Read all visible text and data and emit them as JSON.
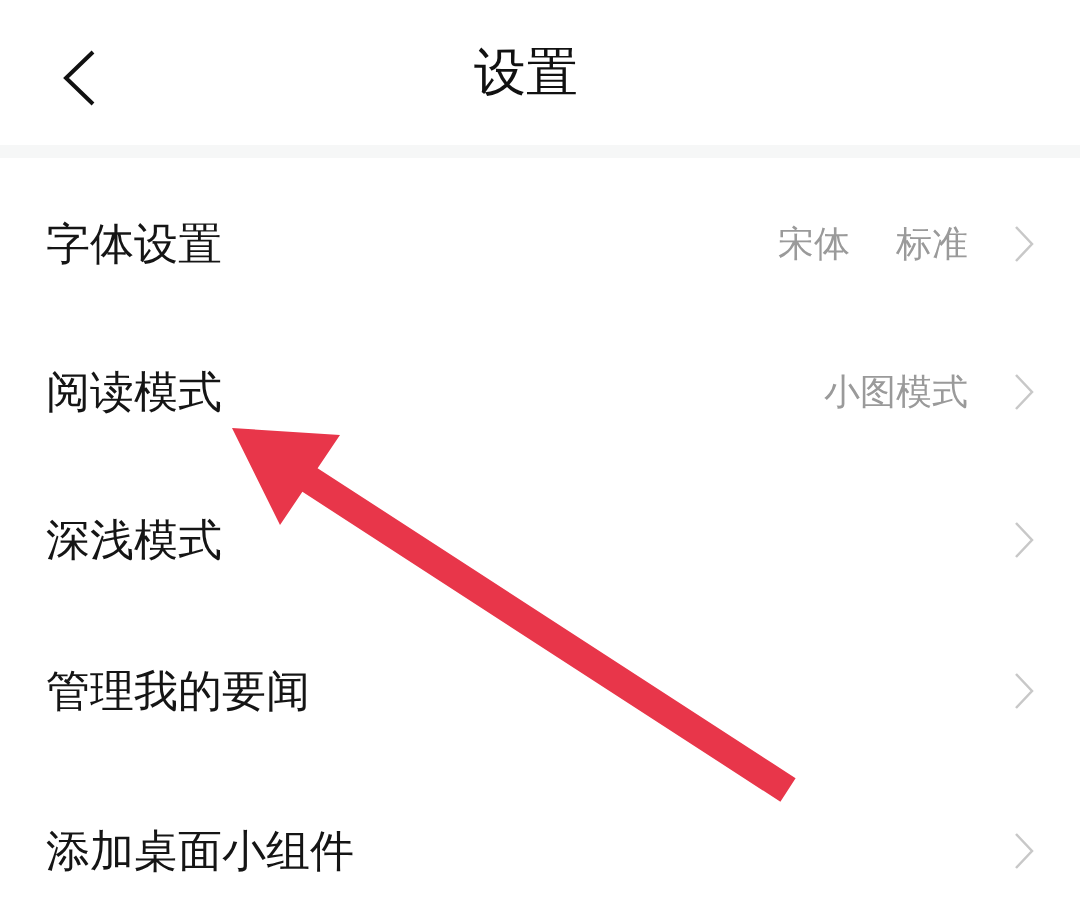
{
  "header": {
    "title": "设置"
  },
  "settings": [
    {
      "label": "字体设置",
      "values": [
        "宋体",
        "标准"
      ]
    },
    {
      "label": "阅读模式",
      "values": [
        "小图模式"
      ]
    },
    {
      "label": "深浅模式"
    },
    {
      "label": "管理我的要闻"
    },
    {
      "label": "添加桌面小组件"
    }
  ],
  "annotation": {
    "kind": "arrow"
  }
}
